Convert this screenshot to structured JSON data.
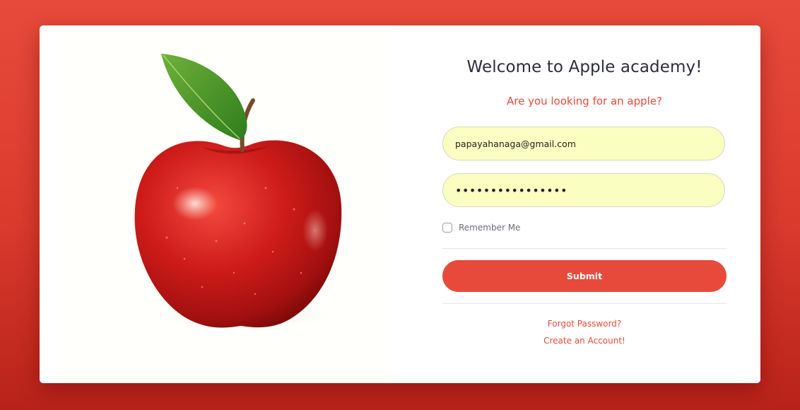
{
  "page": {
    "title": "Welcome to Apple academy!",
    "subtitle": "Are you looking for an apple?"
  },
  "form": {
    "email_value": "papayahanaga@gmail.com",
    "password_value": "password12345678",
    "remember_label": "Remember Me",
    "remember_checked": false,
    "submit_label": "Submit"
  },
  "links": {
    "forgot_password": "Forgot Password?",
    "create_account": "Create an Account!"
  },
  "illustration": {
    "icon": "apple-illustration"
  },
  "colors": {
    "accent": "#e74a3b",
    "input_background": "#fafec0",
    "title": "#2e2e3e"
  }
}
